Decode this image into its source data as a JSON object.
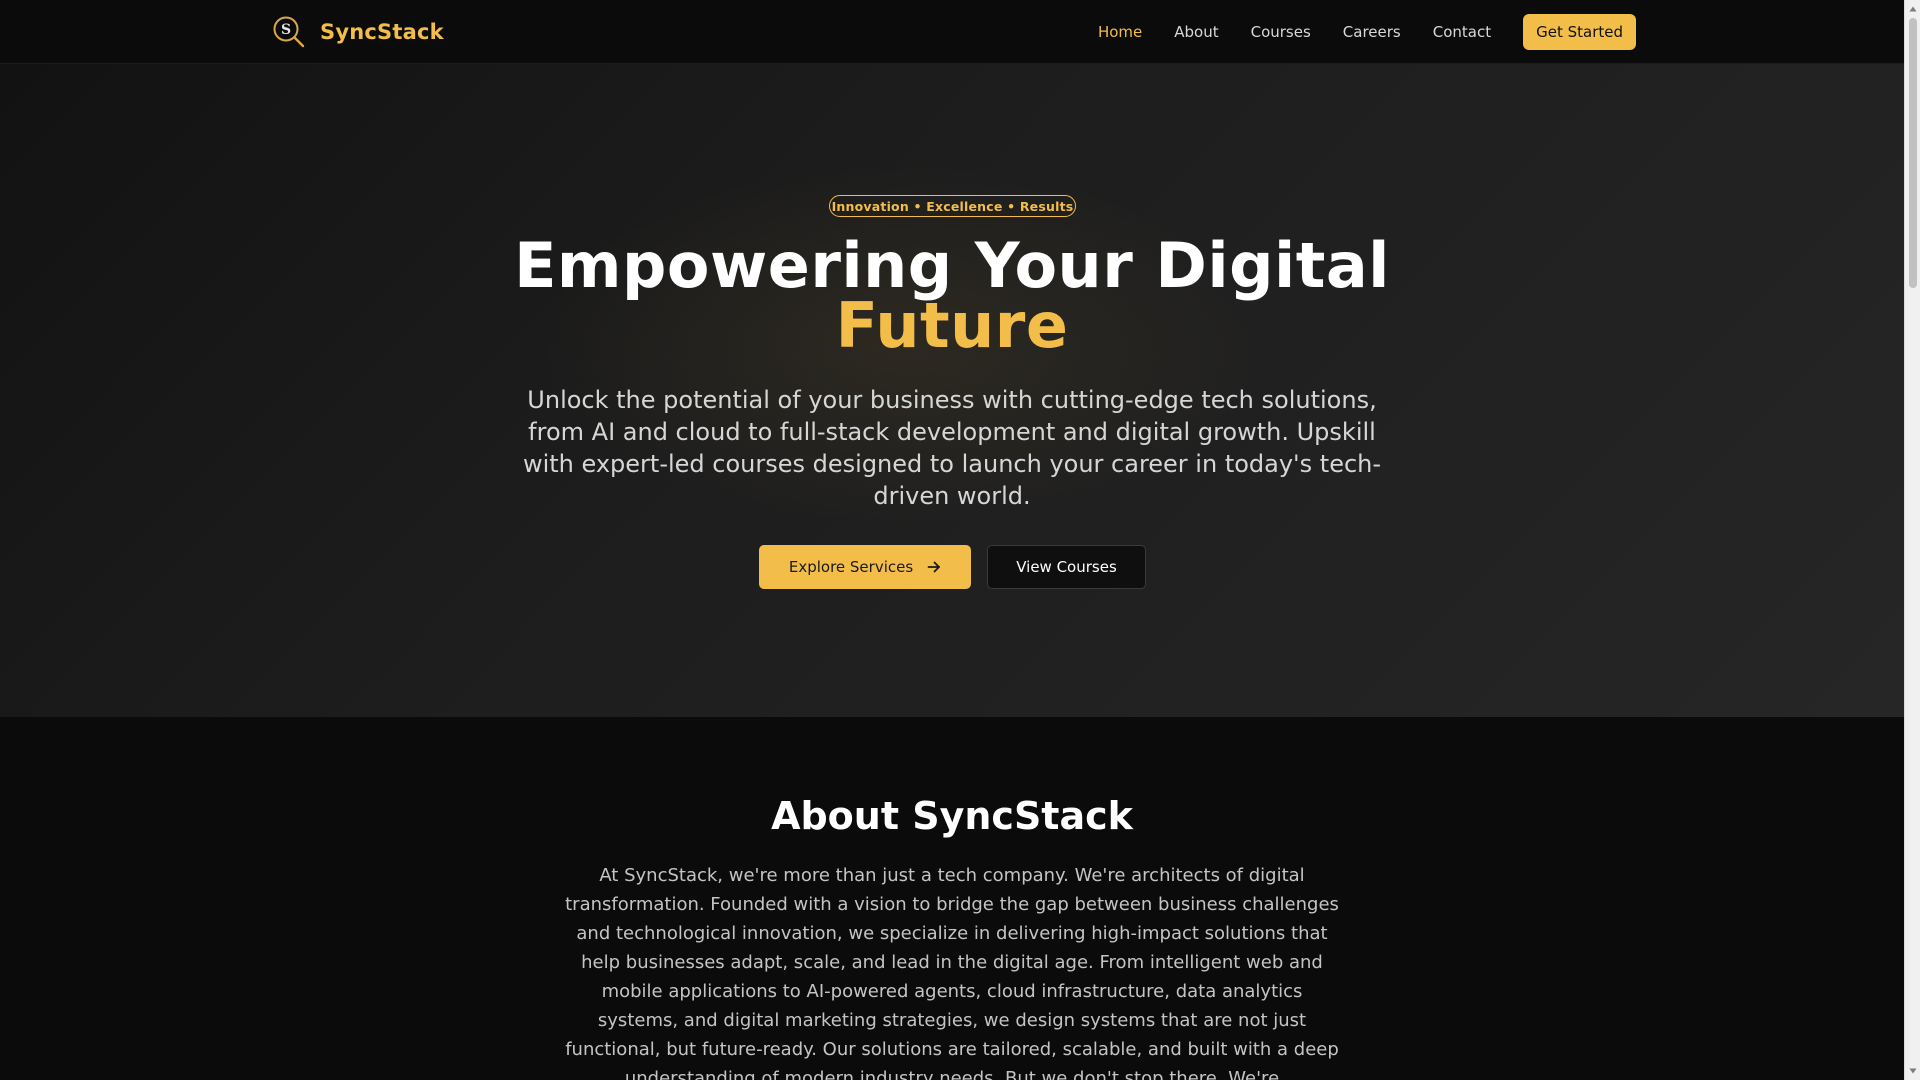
{
  "header": {
    "brand_name": "SyncStack",
    "logo_letter": "S",
    "nav": [
      {
        "label": "Home",
        "active": true
      },
      {
        "label": "About"
      },
      {
        "label": "Courses"
      },
      {
        "label": "Careers"
      },
      {
        "label": "Contact"
      }
    ],
    "cta_label": "Get Started"
  },
  "hero": {
    "tagline": "Innovation • Excellence • Results",
    "title_line1": "Empowering Your Digital",
    "title_accent": "Future",
    "subtitle": "Unlock the potential of your business with cutting-edge tech solutions, from AI and cloud to full-stack development and digital growth. Upskill with expert-led courses designed to launch your career in today's tech-driven world.",
    "primary_button": "Explore Services",
    "secondary_button": "View Courses"
  },
  "about": {
    "title": "About SyncStack",
    "text": "At SyncStack, we're more than just a tech company. We're architects of digital transformation. Founded with a vision to bridge the gap between business challenges and technological innovation, we specialize in delivering high-impact solutions that help businesses adapt, scale, and lead in the digital age. From intelligent web and mobile applications to AI-powered agents, cloud infrastructure, data analytics systems, and digital marketing strategies, we design systems that are not just functional, but future-ready. Our solutions are tailored, scalable, and built with a deep understanding of modern industry needs. But we don't stop there. We're"
  },
  "colors": {
    "accent": "#f3bd4a",
    "background": "#0b0b0b",
    "hero_background": "#1d1d1d"
  },
  "icons": {
    "logo": "s-magnifier-logo-icon",
    "arrow": "arrow-right-icon"
  }
}
